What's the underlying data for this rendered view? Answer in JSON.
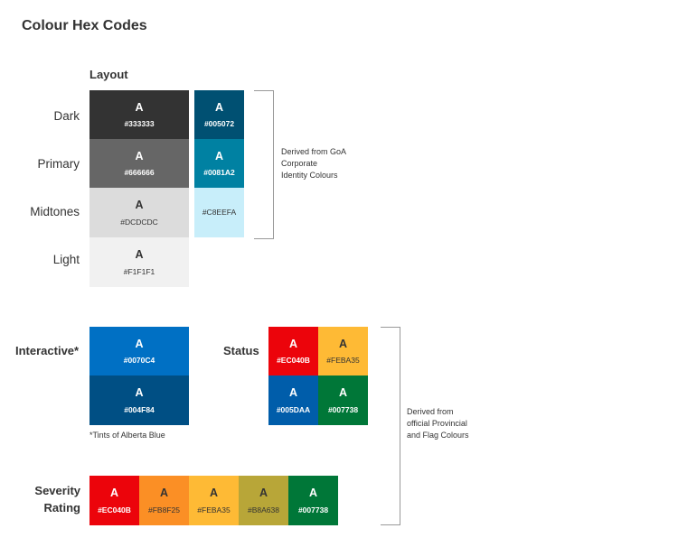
{
  "title": "Colour Hex Codes",
  "layout": {
    "heading": "Layout",
    "rows": [
      {
        "label": "Dark"
      },
      {
        "label": "Primary"
      },
      {
        "label": "Midtones"
      },
      {
        "label": "Light"
      }
    ],
    "greys": [
      {
        "letter": "A",
        "hex": "#333333",
        "color": "#333333",
        "text": "light"
      },
      {
        "letter": "A",
        "hex": "#666666",
        "color": "#666666",
        "text": "light"
      },
      {
        "letter": "A",
        "hex": "#DCDCDC",
        "color": "#DCDCDC",
        "text": "dark"
      },
      {
        "letter": "A",
        "hex": "#F1F1F1",
        "color": "#F1F1F1",
        "text": "dark"
      }
    ],
    "blues": [
      {
        "letter": "A",
        "hex": "#005072",
        "color": "#005072",
        "text": "light"
      },
      {
        "letter": "A",
        "hex": "#0081A2",
        "color": "#0081A2",
        "text": "light"
      },
      {
        "letter": "",
        "hex": "#C8EEFA",
        "color": "#C8EEFA",
        "text": "dark"
      }
    ],
    "note": [
      "Derived from GoA",
      "Corporate",
      "Identity Colours"
    ]
  },
  "interactive": {
    "heading": "Interactive*",
    "swatches": [
      {
        "letter": "A",
        "hex": "#0070C4",
        "color": "#0070C4",
        "text": "light"
      },
      {
        "letter": "A",
        "hex": "#004F84",
        "color": "#004F84",
        "text": "light"
      }
    ],
    "footnote": "*Tints of Alberta Blue"
  },
  "status": {
    "heading": "Status",
    "swatches": [
      {
        "letter": "A",
        "hex": "#EC040B",
        "color": "#EC040B",
        "text": "light"
      },
      {
        "letter": "A",
        "hex": "#FEBA35",
        "color": "#FEBA35",
        "text": "dark"
      },
      {
        "letter": "A",
        "hex": "#005DAA",
        "color": "#005DAA",
        "text": "light"
      },
      {
        "letter": "A",
        "hex": "#007738",
        "color": "#007738",
        "text": "light"
      }
    ]
  },
  "severity": {
    "heading_line1": "Severity",
    "heading_line2": "Rating",
    "swatches": [
      {
        "letter": "A",
        "hex": "#EC040B",
        "color": "#EC040B",
        "text": "light"
      },
      {
        "letter": "A",
        "hex": "#FB8F25",
        "color": "#FB8F25",
        "text": "dark"
      },
      {
        "letter": "A",
        "hex": "#FEBA35",
        "color": "#FEBA35",
        "text": "dark"
      },
      {
        "letter": "A",
        "hex": "#B8A638",
        "color": "#B8A638",
        "text": "dark"
      },
      {
        "letter": "A",
        "hex": "#007738",
        "color": "#007738",
        "text": "light"
      }
    ]
  },
  "provincial_note": [
    "Derived from",
    "official Provincial",
    "and Flag Colours"
  ]
}
